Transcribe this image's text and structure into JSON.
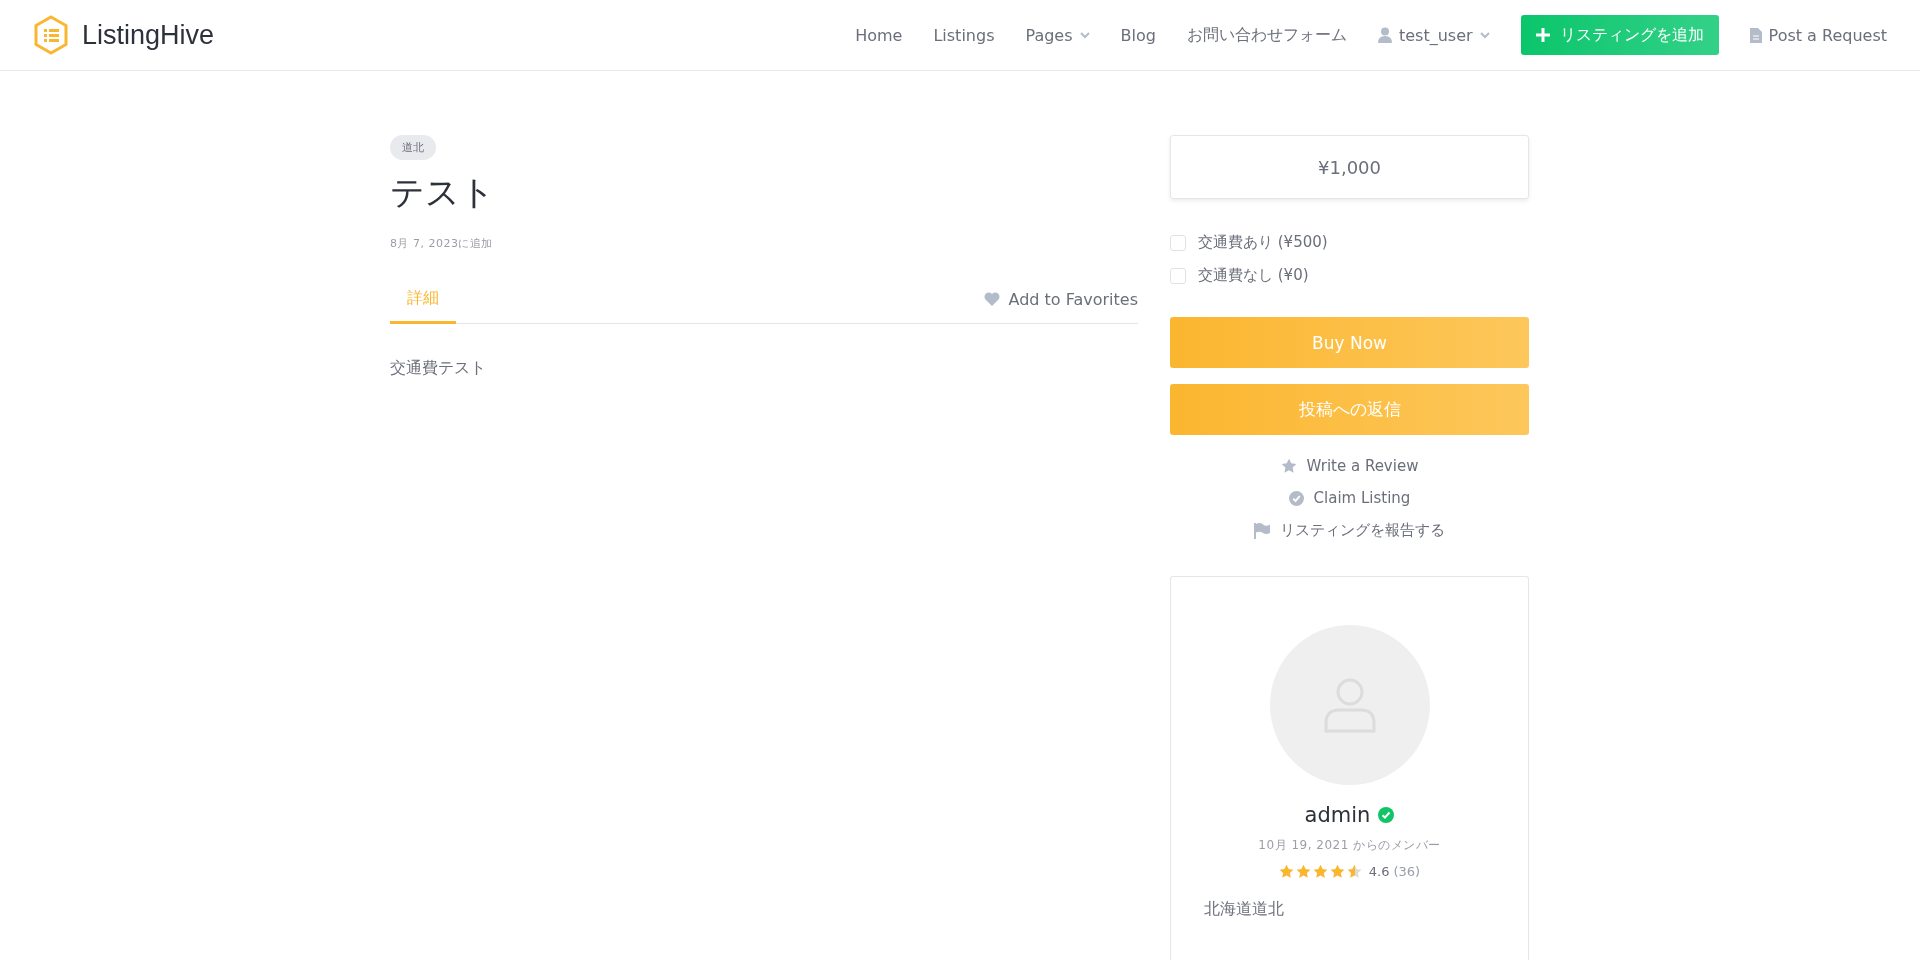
{
  "header": {
    "logo": "ListingHive",
    "nav": [
      {
        "kind": "link",
        "label": "Home",
        "dropdown": false
      },
      {
        "kind": "link",
        "label": "Listings",
        "dropdown": false
      },
      {
        "kind": "link",
        "label": "Pages",
        "dropdown": true
      },
      {
        "kind": "link",
        "label": "Blog",
        "dropdown": false
      },
      {
        "kind": "link",
        "label": "お問い合わせフォーム",
        "dropdown": false
      },
      {
        "kind": "user",
        "label": "test_user",
        "dropdown": true
      }
    ],
    "add_button": "リスティングを追加",
    "request_link": "Post a Request"
  },
  "listing": {
    "tag": "道北",
    "title": "テスト",
    "added": "8月 7, 2023に追加",
    "tabs": [
      {
        "label": "詳細",
        "selected": true
      }
    ],
    "favorite": "Add to Favorites",
    "description": "交通費テスト"
  },
  "sidebar": {
    "price": "¥1,000",
    "options": [
      {
        "label": "交通費あり (¥500)",
        "checked": false
      },
      {
        "label": "交通費なし (¥0)",
        "checked": false
      }
    ],
    "buttons": [
      "Buy Now",
      "投稿への返信"
    ],
    "links": [
      {
        "kind": "star",
        "label": "Write a Review"
      },
      {
        "kind": "check",
        "label": "Claim Listing"
      },
      {
        "kind": "flag",
        "label": "リスティングを報告する"
      }
    ],
    "vendor": {
      "name": "admin",
      "verified": true,
      "member_since": "10月 19, 2021 からのメンバー",
      "stars": 4.5,
      "rating": "4.6",
      "reviews": "(36)",
      "location": "北海道道北"
    }
  }
}
